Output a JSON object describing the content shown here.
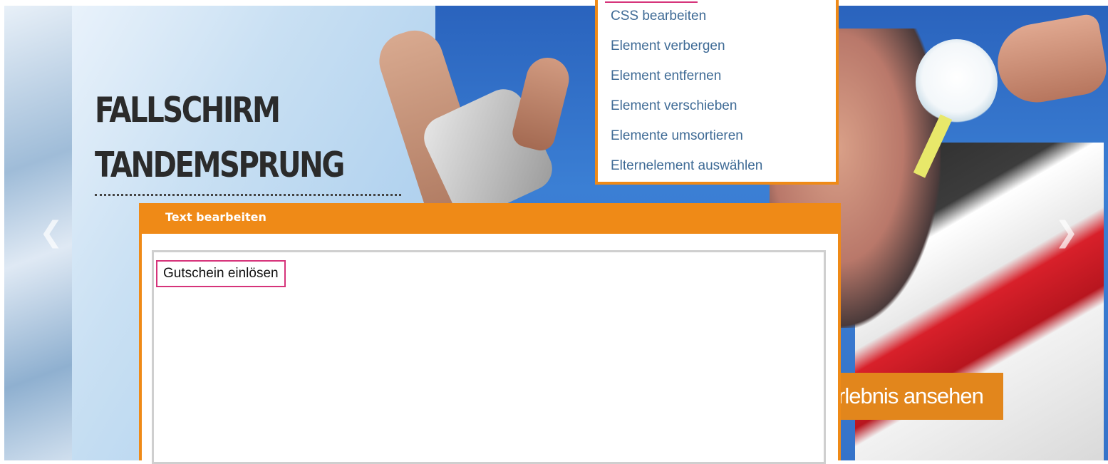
{
  "hero": {
    "title_line1": "FALLSCHIRM",
    "title_line2": "TANDEMSPRUNG",
    "prev_icon": "chevron-left-icon",
    "next_icon": "chevron-right-icon",
    "cta_label": "rlebnis ansehen",
    "accent_color": "#ef8a17"
  },
  "context_menu": {
    "items": [
      "CSS bearbeiten",
      "Element verbergen",
      "Element entfernen",
      "Element verschieben",
      "Elemente umsortieren",
      "Elternelement auswählen"
    ]
  },
  "dialog": {
    "title": "Text bearbeiten",
    "editor_text": "Gutschein einlösen"
  }
}
